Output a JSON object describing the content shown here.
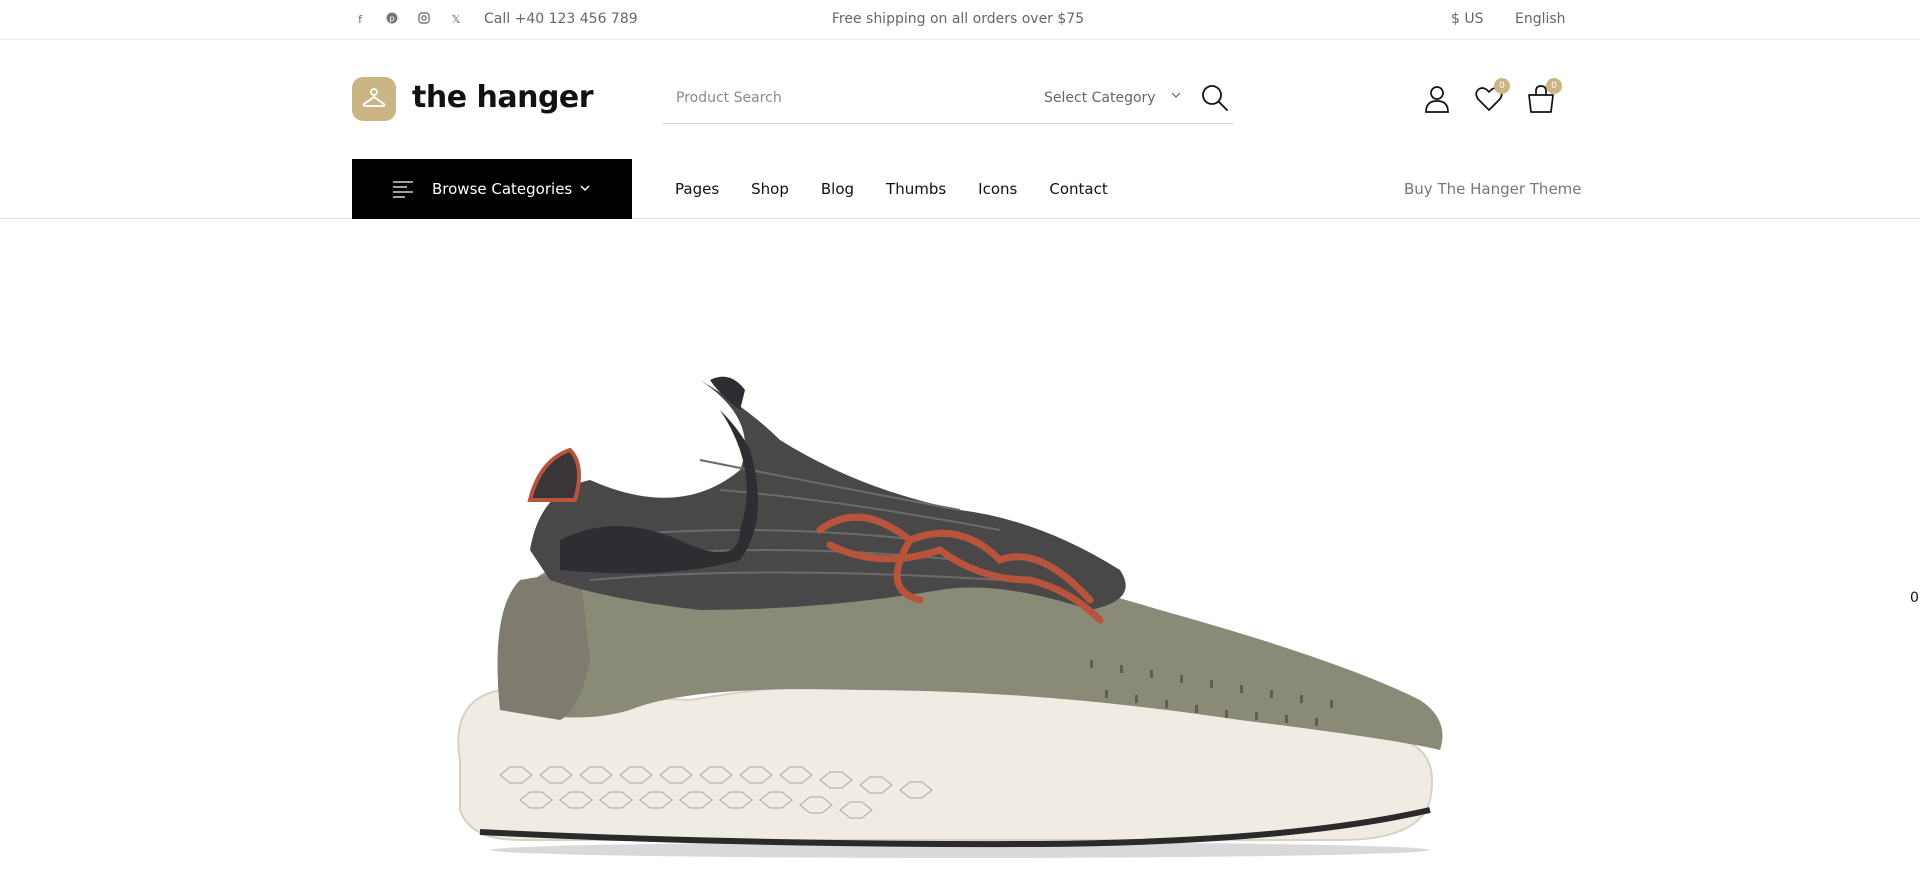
{
  "topbar": {
    "social": [
      "facebook-icon",
      "pinterest-icon",
      "instagram-icon",
      "x-icon"
    ],
    "phone": "Call +40 123 456 789",
    "shipping": "Free shipping on all orders over $75",
    "currency": "$ US",
    "language": "English"
  },
  "header": {
    "logo_text": "the hanger",
    "search_placeholder": "Product Search",
    "category_select": "Select Category",
    "wishlist_count": "0",
    "cart_count": "0"
  },
  "nav": {
    "browse_label": "Browse Categories",
    "menu": [
      "Pages",
      "Shop",
      "Blog",
      "Thumbs",
      "Icons",
      "Contact"
    ],
    "buy_link": "Buy The Hanger Theme"
  },
  "hero": {
    "side_counter": "0",
    "product_colors": {
      "upper_dark": "#3d3b40",
      "body": "#8a8a78",
      "sole": "#f1ece3",
      "laces": "#b8543c",
      "accent": "#c9b684"
    }
  }
}
